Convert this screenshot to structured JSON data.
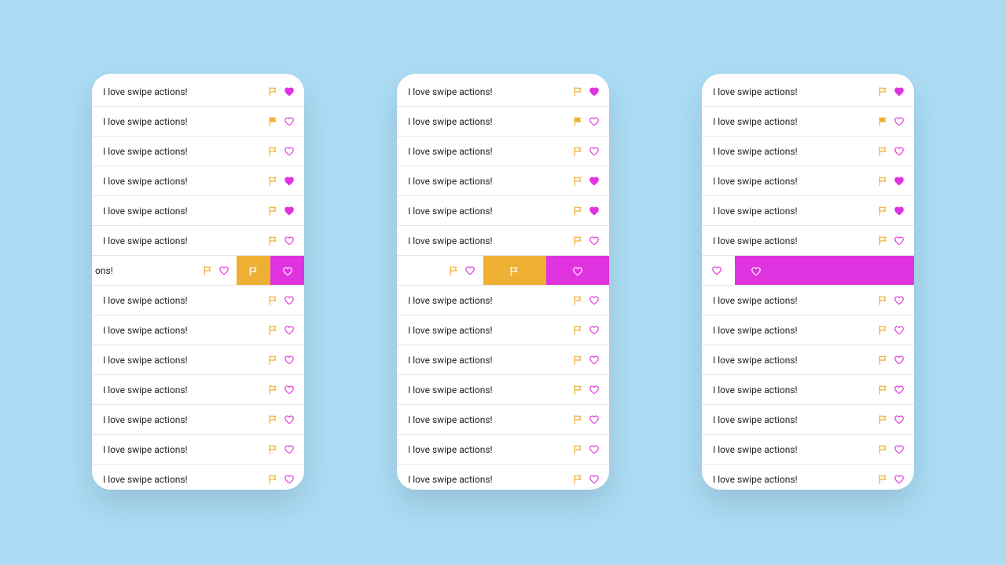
{
  "colors": {
    "orange": "#eeb033",
    "pink": "#e033e0",
    "white": "#ffffff"
  },
  "row_text": "I love swipe actions!",
  "row_text_truncated": "ons!",
  "rows": [
    {
      "flag": "outline",
      "heart": "filled"
    },
    {
      "flag": "filled",
      "heart": "outline"
    },
    {
      "flag": "outline",
      "heart": "outline"
    },
    {
      "flag": "outline",
      "heart": "filled"
    },
    {
      "flag": "outline",
      "heart": "filled"
    },
    {
      "flag": "outline",
      "heart": "outline"
    },
    {
      "flag": "outline",
      "heart": "outline",
      "swiped": true
    },
    {
      "flag": "outline",
      "heart": "outline"
    },
    {
      "flag": "outline",
      "heart": "outline"
    },
    {
      "flag": "outline",
      "heart": "outline"
    },
    {
      "flag": "outline",
      "heart": "outline"
    },
    {
      "flag": "outline",
      "heart": "outline"
    },
    {
      "flag": "outline",
      "heart": "outline"
    },
    {
      "flag": "outline",
      "heart": "outline"
    }
  ],
  "phones": [
    {
      "id": "a",
      "swipe_level": "swipe"
    },
    {
      "id": "b",
      "swipe_level": "swipe-mid"
    },
    {
      "id": "c",
      "swipe_level": "swipe-far"
    }
  ]
}
